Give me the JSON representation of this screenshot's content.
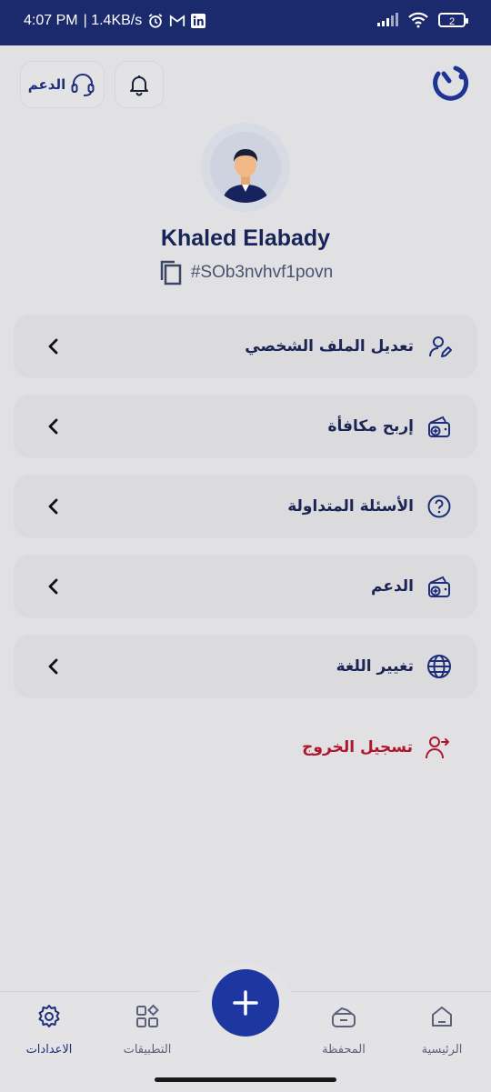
{
  "status_bar": {
    "time": "4:07 PM",
    "speed": "| 1.4KB/s",
    "battery": "2"
  },
  "header": {
    "support_label": "الدعم"
  },
  "profile": {
    "name": "Khaled Elabady",
    "code": "#SOb3nvhvf1povn"
  },
  "menu": {
    "items": [
      {
        "label": "تعديل الملف الشخصي",
        "icon": "user-edit-icon"
      },
      {
        "label": "إربح مكافأة",
        "icon": "wallet-add-icon"
      },
      {
        "label": "الأسئلة المتداولة",
        "icon": "question-circle-icon"
      },
      {
        "label": "الدعم",
        "icon": "wallet-add-icon"
      },
      {
        "label": "تغيير اللغة",
        "icon": "globe-icon"
      }
    ],
    "logout_label": "تسجيل الخروج"
  },
  "bottom_nav": {
    "home": "الرئيسية",
    "wallet": "المحفظة",
    "apps": "التطبيقات",
    "settings": "الاعدادات"
  },
  "colors": {
    "primary": "#1d36a0",
    "navy_text": "#1b2454",
    "logout_red": "#b0152e",
    "status_bar": "#1a2a6c"
  }
}
